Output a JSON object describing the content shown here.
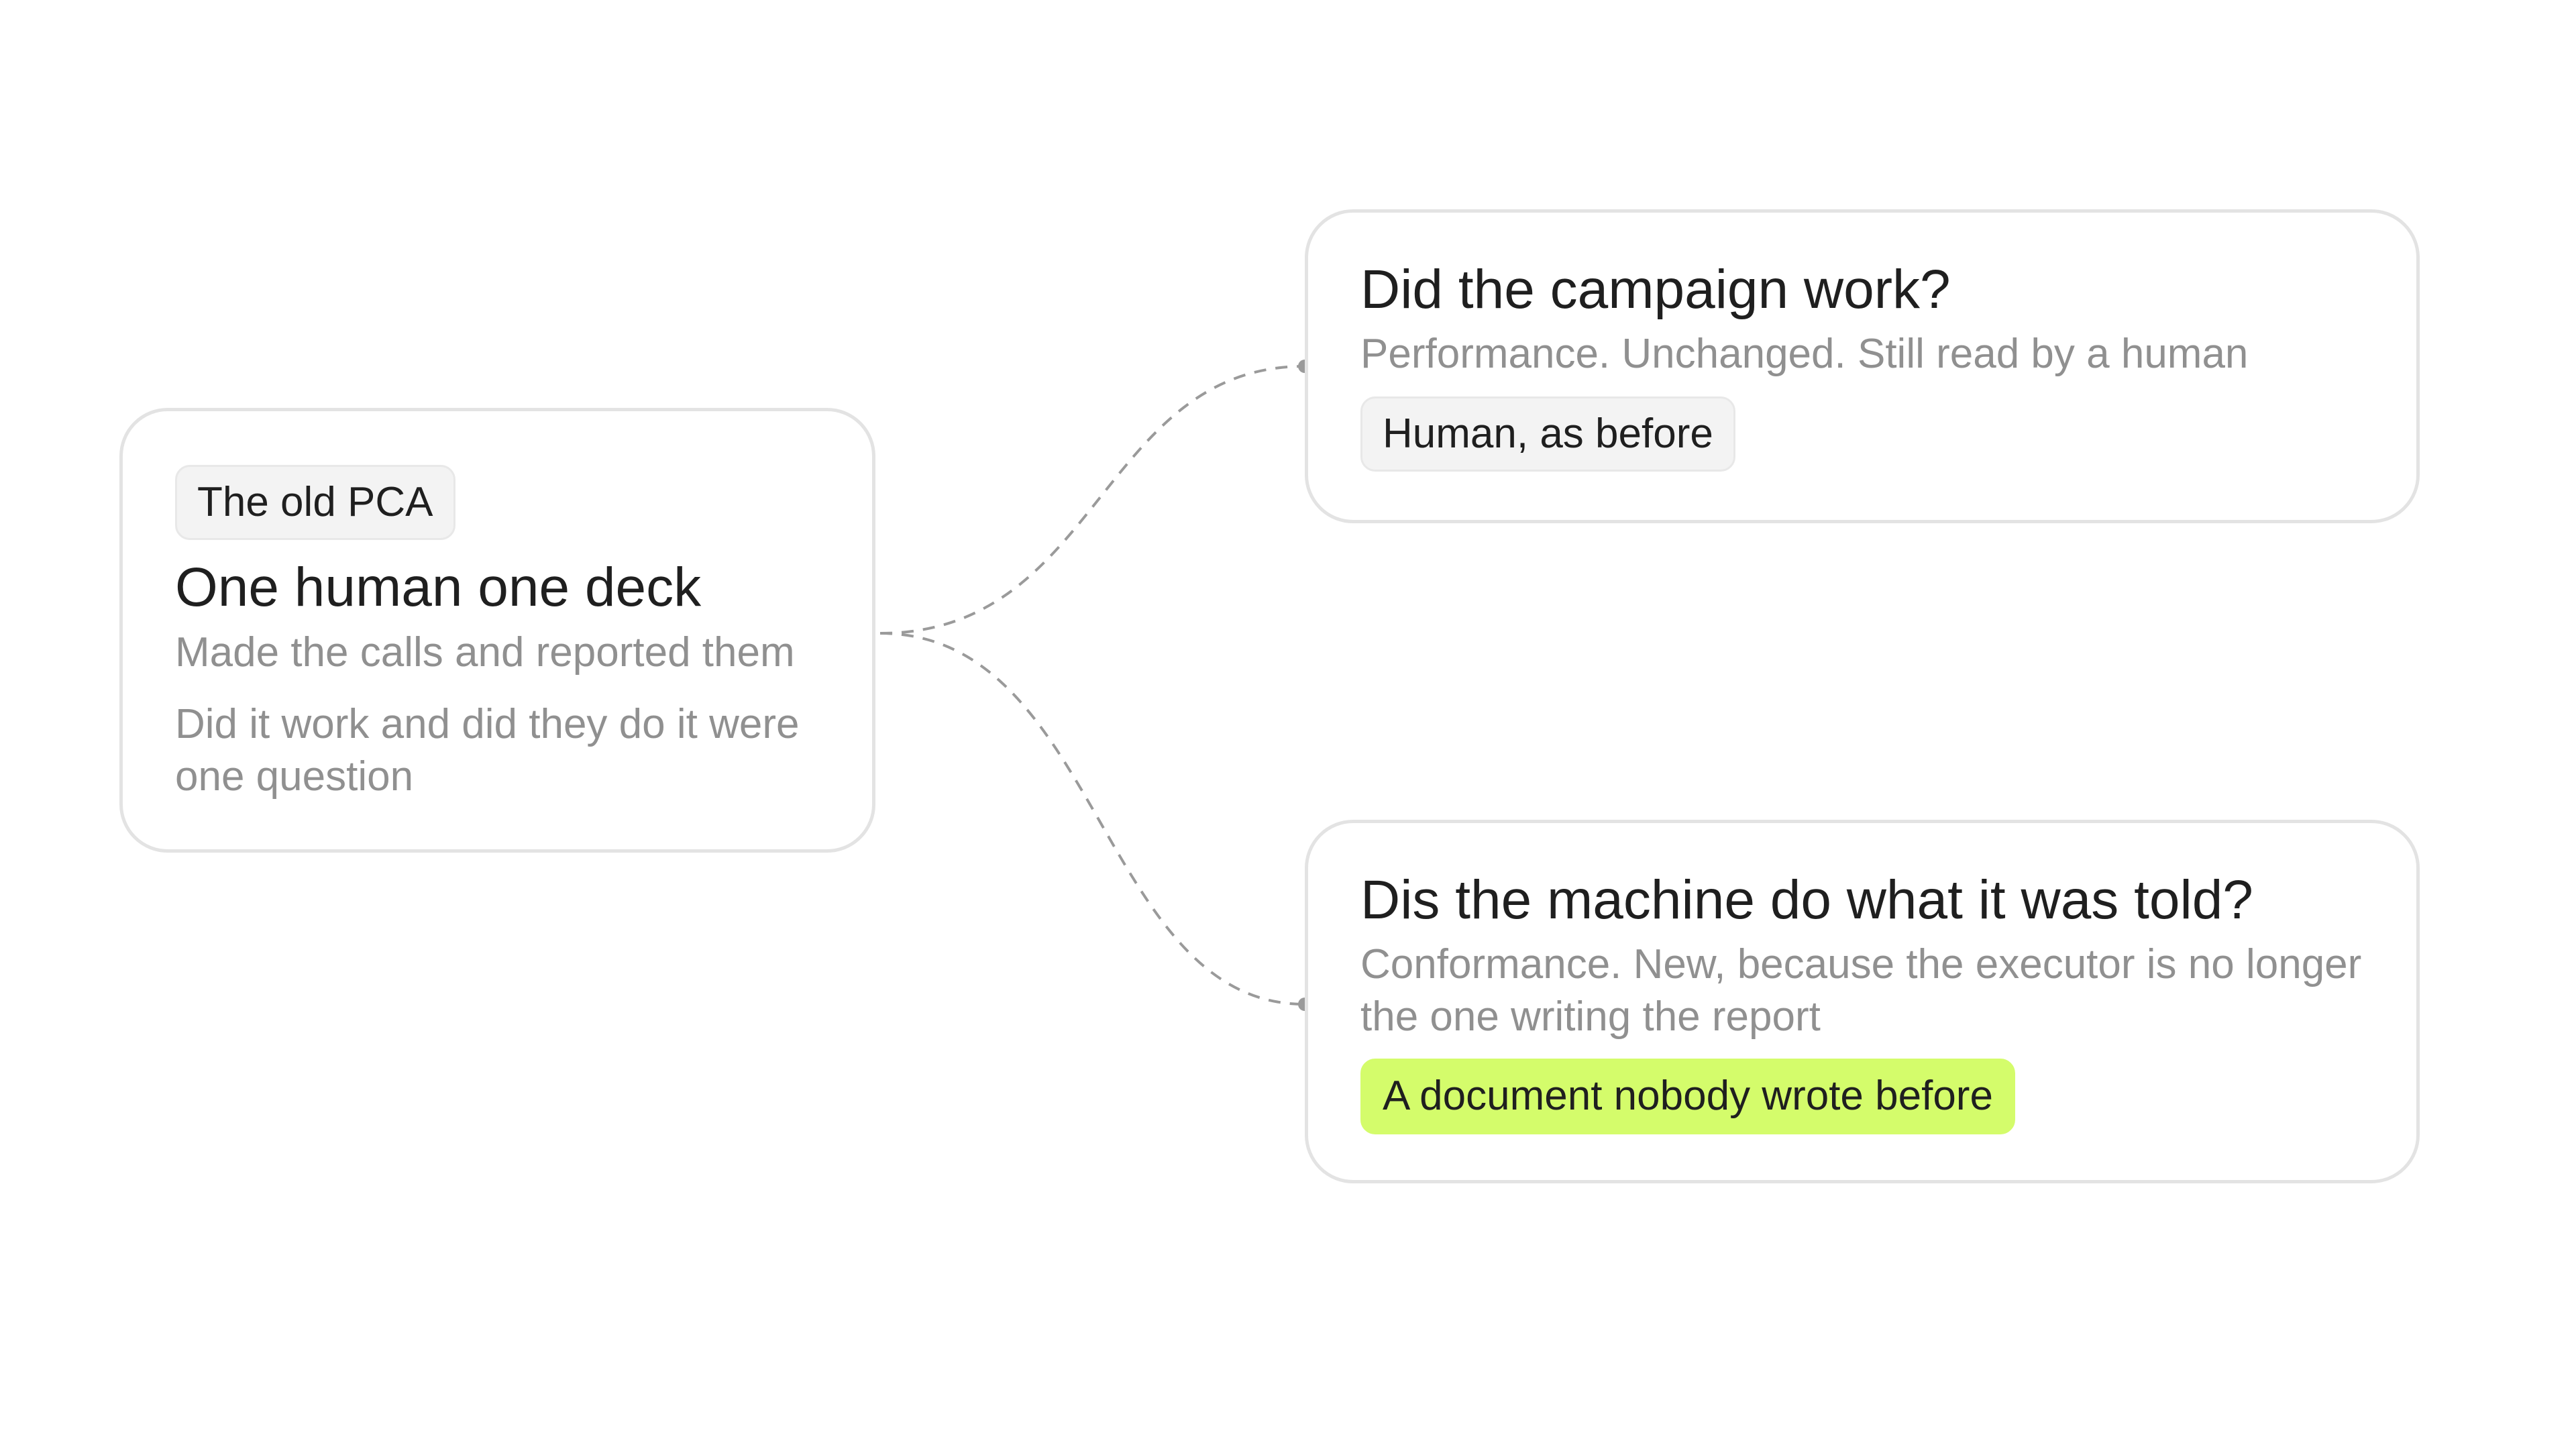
{
  "diagram": {
    "source": {
      "tag": "The old PCA",
      "title": "One human one deck",
      "subtitle": "Made the calls and reported them",
      "note": "Did it work and did they do it were one question"
    },
    "branches": [
      {
        "title": "Did the campaign work?",
        "subtitle": "Performance. Unchanged. Still read by a human",
        "tag": "Human, as before"
      },
      {
        "title": "Dis the machine do what it was told?",
        "subtitle": "Conformance. New, because the executor is no longer the one writing the report",
        "tag": "A document nobody wrote before"
      }
    ],
    "colors": {
      "accent": "#d4fc6b",
      "border": "#e3e3e3",
      "muted_text": "#909090",
      "connector": "#9a9a9a"
    }
  }
}
